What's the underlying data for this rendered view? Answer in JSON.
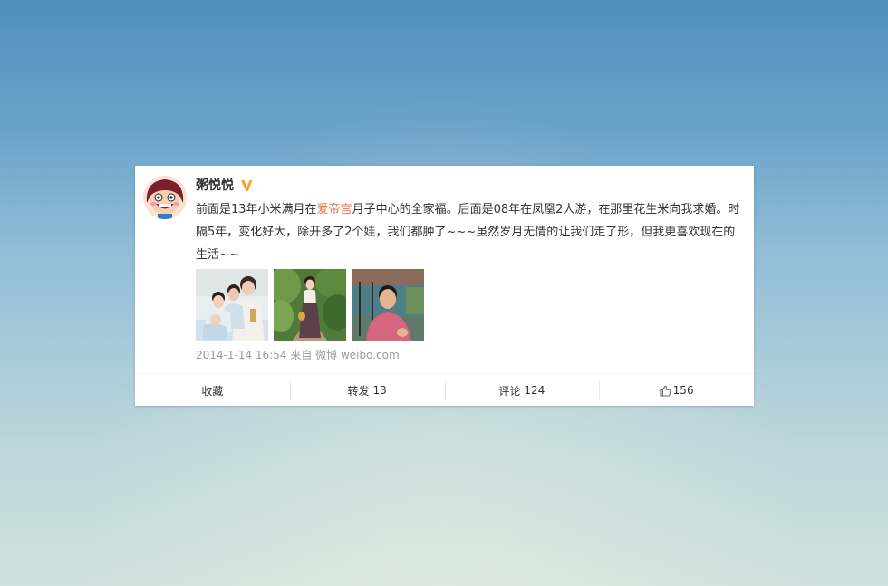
{
  "post": {
    "username": "粥悦悦",
    "verified_icon": "verified-v-icon",
    "text_before_link": "前面是13年小米满月在",
    "link_text": "爱帝宫",
    "text_after_link": "月子中心的全家福。后面是08年在凤凰2人游，在那里花生米向我求婚。时隔5年，变化好大，除开多了2个娃，我们都肿了~~~虽然岁月无情的让我们走了形，但我更喜欢现在的生活~~",
    "timestamp": "2014-1-14 16:54",
    "source_prefix": "来自",
    "source": "微博 weibo.com",
    "photos": [
      "family-photo",
      "woman-in-garden-photo",
      "man-outdoor-photo"
    ]
  },
  "actions": {
    "favorite_label": "收藏",
    "repost_label": "转发",
    "repost_count": "13",
    "comment_label": "评论",
    "comment_count": "124",
    "like_count": "156"
  },
  "colors": {
    "link": "#eb7350",
    "verified": "#f5a623",
    "meta_text": "#999999"
  }
}
